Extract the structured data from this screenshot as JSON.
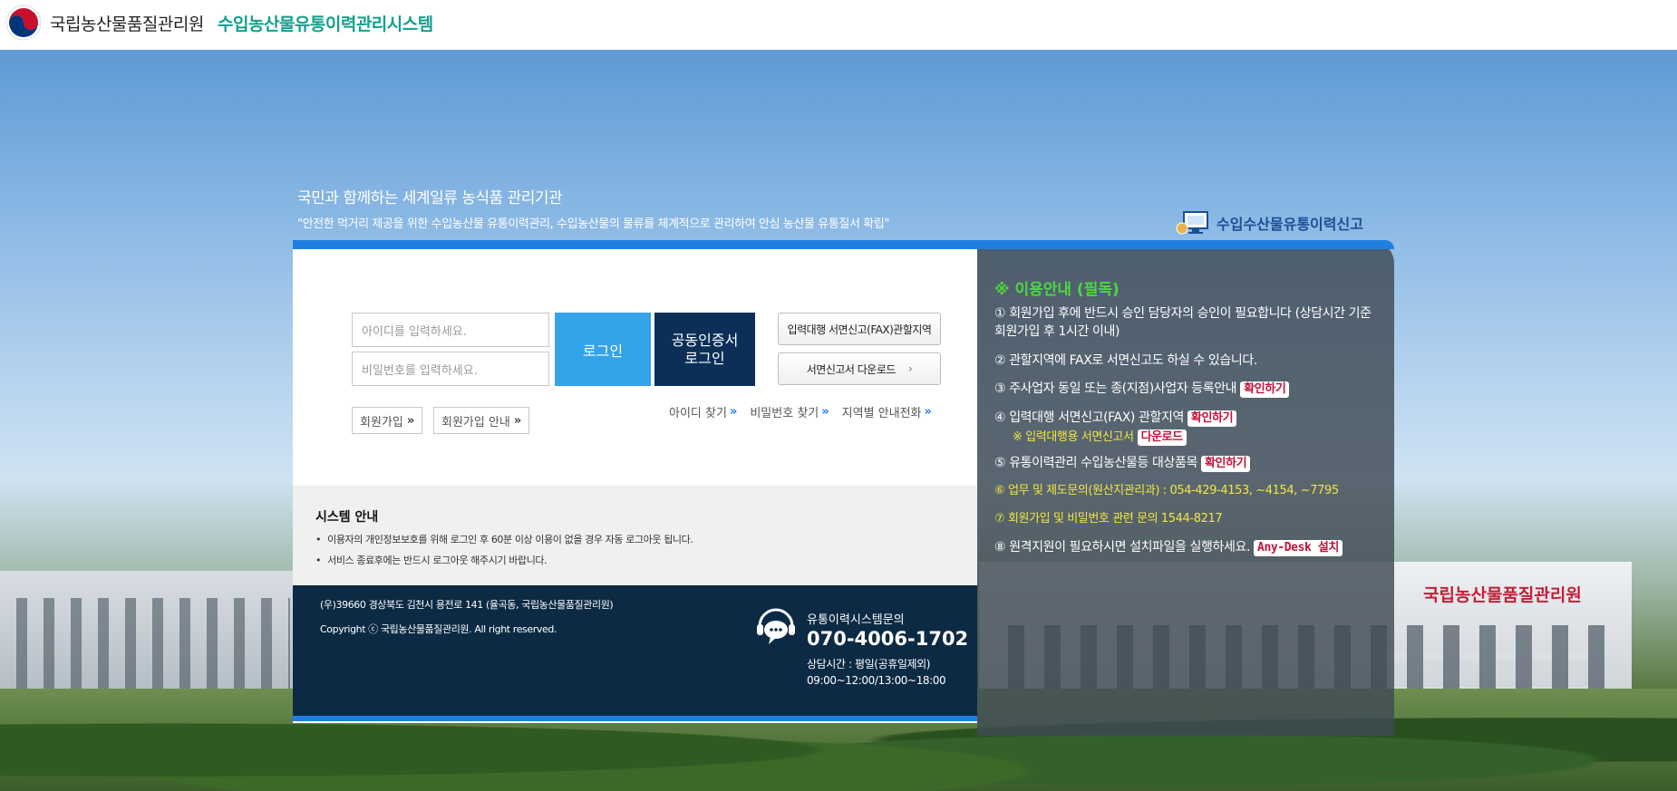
{
  "header": {
    "org_name": "국립농산물품질관리원",
    "system_name": "수입농산물유통이력관리시스템"
  },
  "hero": {
    "slogan": "국민과 함께하는 세계일류 농식품 관리기관",
    "slogan_sub": "\"안전한 먹거리 제공을 위한 수입농산물 유통이력관리, 수입농산물의 물류를 체계적으로 관리하여 안심 농산물 유통질서 확립\"",
    "report_link": "수입수산물유통이력신고"
  },
  "login": {
    "id_placeholder": "아이디를 입력하세요.",
    "pw_placeholder": "비밀번호를 입력하세요.",
    "login_label": "로그인",
    "cert_login_label": "공동인증서\n로그인",
    "fax_area_label": "입력대행 서면신고(FAX)관할지역",
    "download_label": "서면신고서 다운로드",
    "signup_label": "회원가입",
    "signup_guide_label": "회원가입 안내",
    "find_id": "아이디 찾기",
    "find_pw": "비밀번호 찾기",
    "regional_contact": "지역별 안내전화"
  },
  "system_notice": {
    "title": "시스템 안내",
    "lines": [
      "이용자의 개인정보보호를 위해 로그인 후 60분 이상 이용이 없을 경우 자동 로그아웃 됩니다.",
      "서비스 종료후에는 반드시 로그아웃 해주시기 바랍니다."
    ]
  },
  "footer": {
    "address": "(우)39660 경상북도 김천시 용전로 141 (율곡동, 국립농산물품질관리원)",
    "copyright": "Copyright ⓒ 국립농산물품질관리원. All right reserved.",
    "contact_title": "유통이력시스템문의",
    "phone": "070-4006-1702",
    "hours_1": "상담시간 : 평일(공휴일제외)",
    "hours_2": "09:00~12:00/13:00~18:00"
  },
  "info_panel": {
    "title": "※ 이용안내 (필독)",
    "item1": "① 회원가입 후에 반드시 승인 담당자의 승인이 필요합니다 (상담시간 기준 회원가입 후 1시간 이내)",
    "item2": "② 관할지역에 FAX로 서면신고도 하실 수 있습니다.",
    "item3": "③ 주사업자 동일 또는 종(지점)사업자 등록안내",
    "item3_tag": "확인하기",
    "item4": "④ 입력대행 서면신고(FAX) 관할지역",
    "item4_tag": "확인하기",
    "item4_sub": "※ 입력대행용 서면신고서",
    "item4_sub_tag": "다운로드",
    "item5": "⑤ 유통이력관리 수입농산물등 대상품목",
    "item5_tag": "확인하기",
    "item6": "⑥ 업무 및 제도문의(원산지관리과) : 054-429-4153, ~4154, ~7795",
    "item7": "⑦ 회원가입 및 비밀번호 관련 문의 1544-8217",
    "item8": "⑧ 원격지원이 필요하시면 설치파일을 실행하세요.",
    "item8_tag": "Any-Desk 설치"
  },
  "building_sign": "국립농산물품질관리원",
  "colors": {
    "accent": "#1f7fe0",
    "login_button": "#34a3e9",
    "cert_button": "#0b2f57",
    "footer_bg": "#0c2a44",
    "system_name": "#13a08c",
    "notice_title": "#4cd83e",
    "notice_yellow": "#f3e63f"
  }
}
